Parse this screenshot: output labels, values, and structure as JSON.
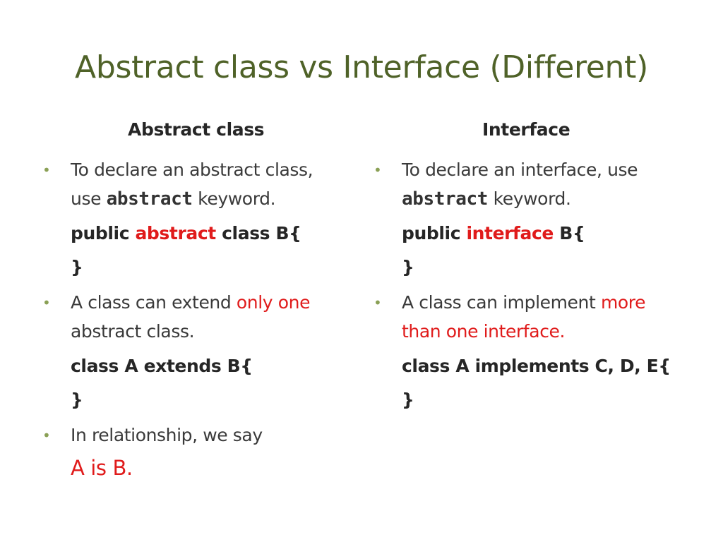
{
  "slide": {
    "title": "Abstract class vs Interface (Different)",
    "accent_color": "#4f6228",
    "highlight_color": "#e01b1b",
    "bullet_icon": "bullet-dot-icon"
  },
  "left": {
    "header": "Abstract class",
    "b1_line1": "To declare an abstract class,",
    "b1_line2_pre": "use ",
    "b1_line2_kw": "abstract",
    "b1_line2_post": " keyword.",
    "code1_pre": "public ",
    "code1_kw": "abstract",
    "code1_post": " class B{",
    "code1_close": "}",
    "b2_line1_pre": "A class can extend ",
    "b2_line1_red": "only one",
    "b2_line2": "abstract class.",
    "code2": "class A extends B{",
    "code2_close": "}",
    "b3_line1": "In relationship, we say",
    "b3_line2": "A is B."
  },
  "right": {
    "header": "Interface",
    "b1_line1": "To declare an interface, use",
    "b1_line2_kw": "abstract",
    "b1_line2_post": " keyword.",
    "code1_pre": "public ",
    "code1_kw": "interface",
    "code1_post": " B{",
    "code1_close": "}",
    "b2_line1_pre": "A class can implement ",
    "b2_line1_red": "more",
    "b2_line2_red": "than one interface.",
    "code2": "class A implements C, D, E{",
    "code2_close": "}"
  }
}
